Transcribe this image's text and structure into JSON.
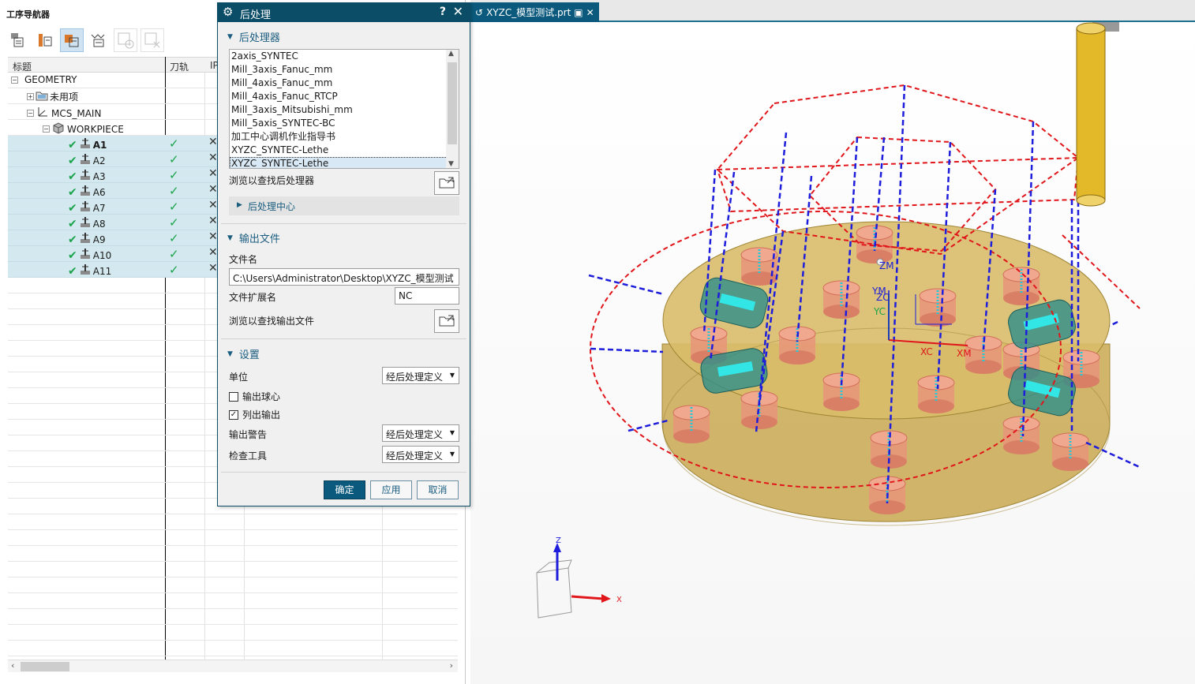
{
  "navigator": {
    "title": "工序导航器",
    "columns": [
      "标题",
      "刀轨",
      "IP"
    ],
    "geometry_label": "GEOMETRY",
    "unused_label": "未用项",
    "mcs_label": "MCS_MAIN",
    "workpiece_label": "WORKPIECE",
    "operations": [
      {
        "name": "A1",
        "check": "✓",
        "ip": "✕"
      },
      {
        "name": "A2",
        "check": "✓",
        "ip": "✕"
      },
      {
        "name": "A3",
        "check": "✓",
        "ip": "✕"
      },
      {
        "name": "A6",
        "check": "✓",
        "ip": "✕"
      },
      {
        "name": "A7",
        "check": "✓",
        "ip": "✕"
      },
      {
        "name": "A8",
        "check": "✓",
        "ip": "✕"
      },
      {
        "name": "A9",
        "check": "✓",
        "ip": "✕"
      },
      {
        "name": "A10",
        "check": "✓",
        "ip": "✕"
      },
      {
        "name": "A11",
        "check": "✓",
        "ip": "✕"
      }
    ]
  },
  "dialog": {
    "title": "后处理",
    "help": "?",
    "close": "✕",
    "section_postprocessor": "后处理器",
    "postprocessors": [
      "2axis_SYNTEC",
      "Mill_3axis_Fanuc_mm",
      "Mill_4axis_Fanuc_mm",
      "Mill_4axis_Fanuc_RTCP",
      "Mill_3axis_Mitsubishi_mm",
      "Mill_5axis_SYNTEC-BC",
      "加工中心调机作业指导书",
      "XYZC_SYNTEC-Lethe",
      "XYZC_SYNTEC-Lethe"
    ],
    "browse_post_label": "浏览以查找后处理器",
    "post_center_label": "后处理中心",
    "section_output": "输出文件",
    "filename_label": "文件名",
    "filename_value": "C:\\Users\\Administrator\\Desktop\\XYZC_模型测试",
    "extension_label": "文件扩展名",
    "extension_value": "NC",
    "browse_output_label": "浏览以查找输出文件",
    "section_settings": "设置",
    "units_label": "单位",
    "units_value": "经后处理定义",
    "output_ball_label": "输出球心",
    "output_ball_checked": "",
    "list_output_label": "列出输出",
    "list_output_checked": "✓",
    "warnings_label": "输出警告",
    "warnings_value": "经后处理定义",
    "check_tool_label": "检查工具",
    "check_tool_value": "经后处理定义",
    "ok": "确定",
    "apply": "应用",
    "cancel": "取消"
  },
  "viewport": {
    "tab_title": "XYZC_模型测试.prt",
    "axis_labels": {
      "zm": "ZM",
      "ym": "YM",
      "zc": "ZC",
      "yc": "YC",
      "xc": "XC",
      "xm": "XM",
      "z": "Z",
      "x": "X"
    }
  },
  "colors": {
    "accent": "#0b5a7d",
    "selection": "#d4e9ef",
    "check": "#1aa34a",
    "toolpath_red": "#e0161b",
    "toolpath_blue": "#1d1ddb",
    "part_fill": "#c8a850",
    "hole_fill": "#e8947a",
    "tool_yellow": "#e3b92a"
  }
}
